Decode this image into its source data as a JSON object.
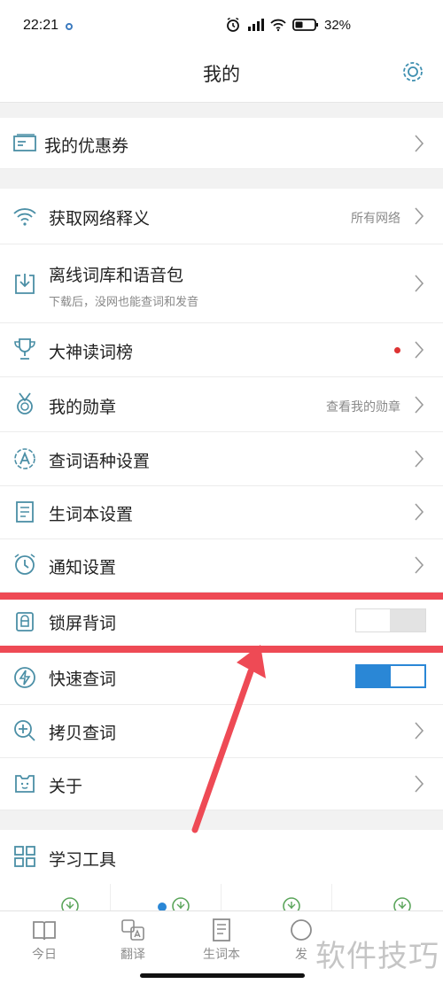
{
  "status_bar": {
    "time": "22:21",
    "battery": "32%"
  },
  "header": {
    "title": "我的"
  },
  "coupon": {
    "label": "我的优惠券"
  },
  "menu": {
    "network": {
      "label": "获取网络释义",
      "value": "所有网络"
    },
    "offline": {
      "label": "离线词库和语音包",
      "sub": "下载后，没网也能查词和发音"
    },
    "ranking": {
      "label": "大神读词榜"
    },
    "medals": {
      "label": "我的勋章",
      "value": "查看我的勋章"
    },
    "language": {
      "label": "查词语种设置"
    },
    "wordbook": {
      "label": "生词本设置"
    },
    "notify": {
      "label": "通知设置"
    },
    "lockscreen": {
      "label": "锁屏背词",
      "enabled": false
    },
    "quick": {
      "label": "快速查词",
      "enabled": true
    },
    "copy": {
      "label": "拷贝查词"
    },
    "about": {
      "label": "关于"
    }
  },
  "tools": {
    "label": "学习工具"
  },
  "tabbar": {
    "today": "今日",
    "translate": "翻译",
    "wordbook": "生词本",
    "discover": "发"
  },
  "watermark": "软件技巧",
  "colors": {
    "accent": "#2a87d6",
    "icon": "#4b8fa6",
    "highlight": "#ee4a55"
  }
}
